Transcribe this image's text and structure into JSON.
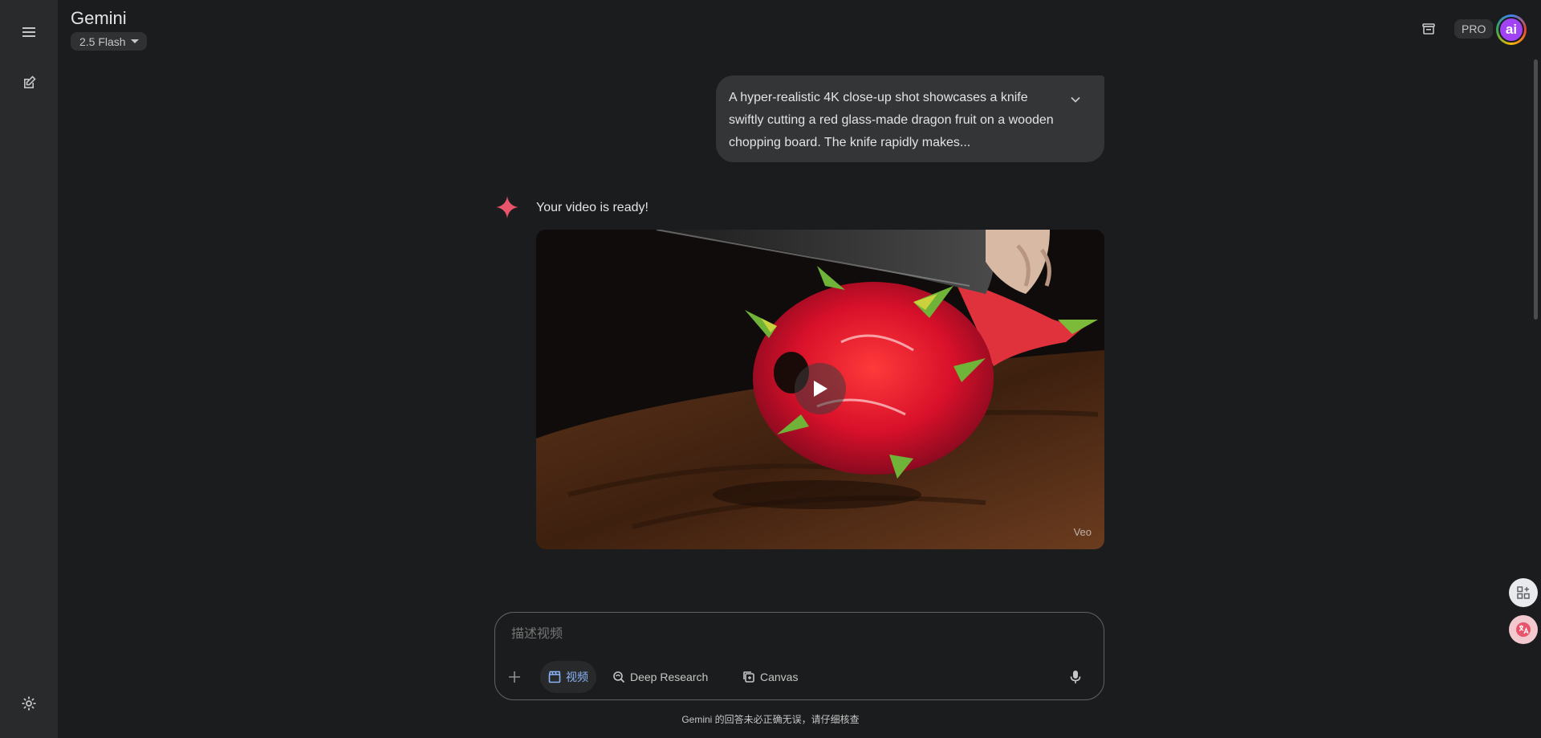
{
  "app": {
    "title": "Gemini",
    "model": "2.5 Flash",
    "plan_badge": "PRO",
    "avatar_initials": "ai"
  },
  "conversation": {
    "user_prompt": "A hyper-realistic 4K close-up shot showcases a knife swiftly cutting a red glass-made dragon fruit on a wooden chopping board. The knife rapidly makes...",
    "assistant_text": "Your video is ready!",
    "video_watermark": "Veo"
  },
  "composer": {
    "placeholder": "描述视频",
    "tools": [
      {
        "label": "视频",
        "icon": "video-clapper-icon",
        "active": true
      },
      {
        "label": "Deep Research",
        "icon": "deep-research-icon",
        "active": false
      },
      {
        "label": "Canvas",
        "icon": "canvas-icon",
        "active": false
      }
    ]
  },
  "disclaimer": "Gemini 的回答未必正确无误，请仔细核查",
  "colors": {
    "accent": "#8ab4f8",
    "background": "#1b1c1d",
    "rail": "#282a2c",
    "spark": "#e8546a"
  }
}
